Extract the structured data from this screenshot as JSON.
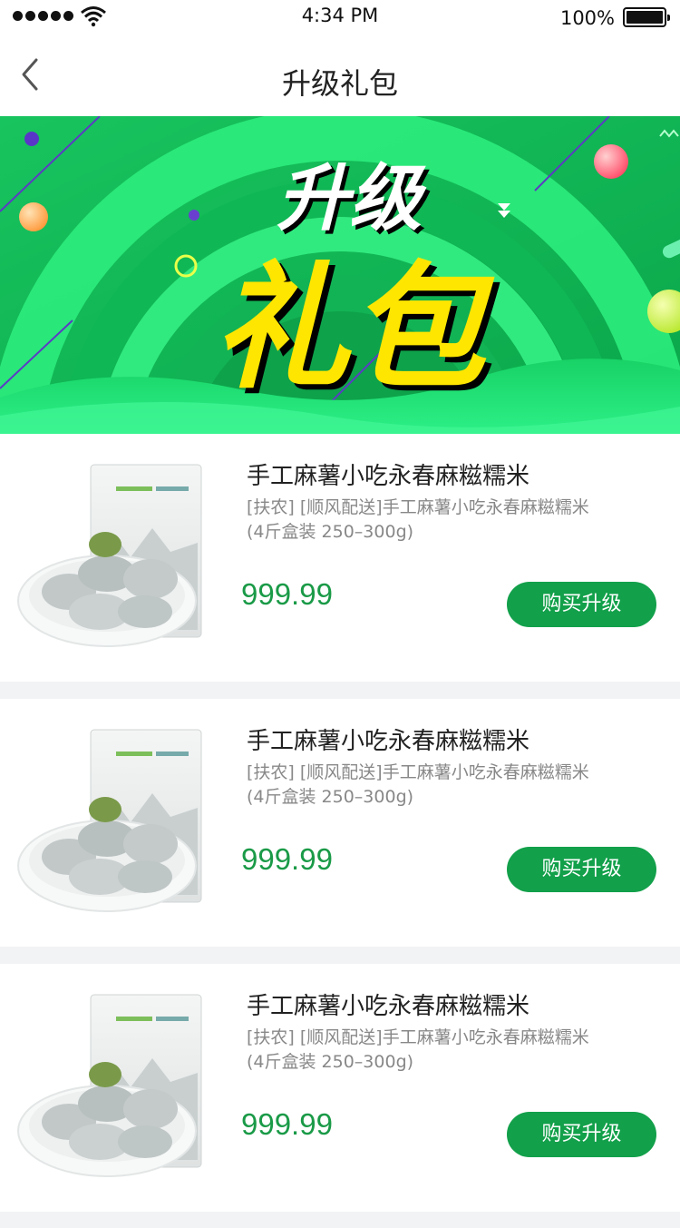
{
  "status_bar": {
    "time": "4:34 PM",
    "battery": "100%"
  },
  "nav": {
    "title": "升级礼包",
    "back_icon": "chevron-left-icon"
  },
  "banner": {
    "line1": "升级",
    "line2": "礼包",
    "colors": {
      "bg": "#0fb755",
      "ring": "#2ef07f",
      "text1": "#ffffff",
      "text2": "#ffe600"
    }
  },
  "products": [
    {
      "name": "手工麻薯小吃永春麻糍糯米",
      "desc_line1": "[扶农] [顺风配送]手工麻薯小吃永春麻糍糯米",
      "desc_line2": "(4斤盒装 250–300g)",
      "price": "999.99",
      "button": "购买升级"
    },
    {
      "name": "手工麻薯小吃永春麻糍糯米",
      "desc_line1": "[扶农] [顺风配送]手工麻薯小吃永春麻糍糯米",
      "desc_line2": "(4斤盒装 250–300g)",
      "price": "999.99",
      "button": "购买升级"
    },
    {
      "name": "手工麻薯小吃永春麻糍糯米",
      "desc_line1": "[扶农] [顺风配送]手工麻薯小吃永春麻糍糯米",
      "desc_line2": "(4斤盒装 250–300g)",
      "price": "999.99",
      "button": "购买升级"
    }
  ],
  "accent_color": "#12a04a"
}
